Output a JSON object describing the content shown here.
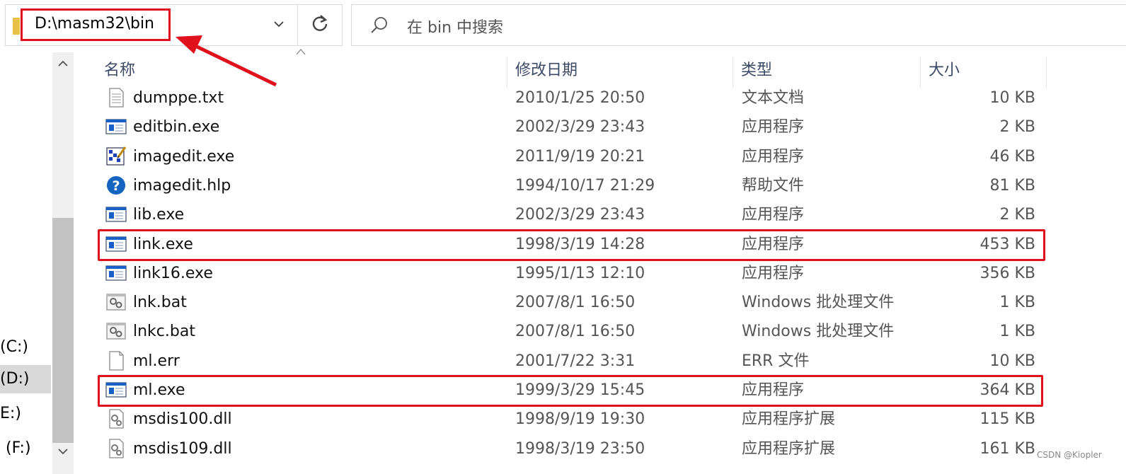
{
  "address_bar": {
    "path": "D:\\masm32\\bin"
  },
  "search": {
    "placeholder": "在 bin 中搜索"
  },
  "nav": {
    "items": [
      {
        "label": "(C:)"
      },
      {
        "label": "(D:)",
        "selected": true
      },
      {
        "label": "E:)"
      },
      {
        "label": "(F:)"
      }
    ]
  },
  "columns": {
    "name": "名称",
    "date": "修改日期",
    "type": "类型",
    "size": "大小"
  },
  "files": [
    {
      "name": "dumppe.txt",
      "date": "2010/1/25 20:50",
      "type": "文本文档",
      "size": "10 KB",
      "icon": "text-file-icon"
    },
    {
      "name": "editbin.exe",
      "date": "2002/3/29 23:43",
      "type": "应用程序",
      "size": "2 KB",
      "icon": "exe-icon"
    },
    {
      "name": "imagedit.exe",
      "date": "2011/9/19 20:21",
      "type": "应用程序",
      "size": "46 KB",
      "icon": "image-editor-icon"
    },
    {
      "name": "imagedit.hlp",
      "date": "1994/10/17 21:29",
      "type": "帮助文件",
      "size": "81 KB",
      "icon": "help-icon"
    },
    {
      "name": "lib.exe",
      "date": "2002/3/29 23:43",
      "type": "应用程序",
      "size": "2 KB",
      "icon": "exe-icon"
    },
    {
      "name": "link.exe",
      "date": "1998/3/19 14:28",
      "type": "应用程序",
      "size": "453 KB",
      "icon": "exe-icon",
      "highlighted": true
    },
    {
      "name": "link16.exe",
      "date": "1995/1/13 12:10",
      "type": "应用程序",
      "size": "356 KB",
      "icon": "exe-icon"
    },
    {
      "name": "lnk.bat",
      "date": "2007/8/1 16:50",
      "type": "Windows 批处理文件",
      "size": "1 KB",
      "icon": "batch-file-icon"
    },
    {
      "name": "lnkc.bat",
      "date": "2007/8/1 16:50",
      "type": "Windows 批处理文件",
      "size": "1 KB",
      "icon": "batch-file-icon"
    },
    {
      "name": "ml.err",
      "date": "2001/7/22 3:31",
      "type": "ERR 文件",
      "size": "10 KB",
      "icon": "blank-file-icon"
    },
    {
      "name": "ml.exe",
      "date": "1999/3/29 15:45",
      "type": "应用程序",
      "size": "364 KB",
      "icon": "exe-icon",
      "highlighted": true
    },
    {
      "name": "msdis100.dll",
      "date": "1998/9/19 19:30",
      "type": "应用程序扩展",
      "size": "115 KB",
      "icon": "dll-icon"
    },
    {
      "name": "msdis109.dll",
      "date": "1998/3/19 23:50",
      "type": "应用程序扩展",
      "size": "161 KB",
      "icon": "dll-icon"
    }
  ],
  "watermark": "CSDN @Kiopler",
  "colors": {
    "highlight": "#e0101c",
    "header_text": "#3c4a66",
    "folder": "#e8c04a",
    "exe_blue": "#1a5fc8"
  }
}
